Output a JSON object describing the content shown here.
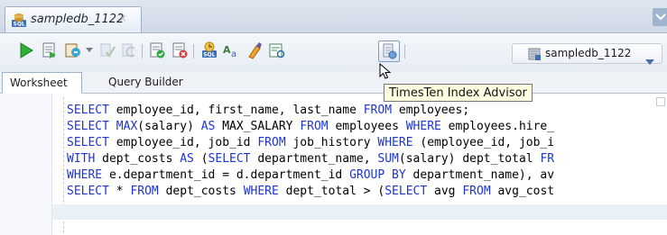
{
  "document_tab": {
    "label": "sampledb_1122",
    "close": "×"
  },
  "toolbar": {
    "buttons": [
      {
        "name": "run-statement-icon",
        "tooltip": ""
      },
      {
        "name": "run-script-icon"
      },
      {
        "name": "autotrace-icon"
      },
      {
        "name": "commit-icon"
      },
      {
        "name": "rollback-icon"
      },
      {
        "name": "explain-plan-icon"
      },
      {
        "name": "sql-tuning-icon"
      },
      {
        "name": "sql-history-icon"
      },
      {
        "name": "to-upper-icon"
      },
      {
        "name": "clear-icon"
      },
      {
        "name": "find-icon"
      },
      {
        "name": "timesten-index-advisor-icon"
      }
    ],
    "connection": "sampledb_1122"
  },
  "subtabs": {
    "worksheet": "Worksheet",
    "query_builder": "Query Builder"
  },
  "tooltip": "TimesTen Index Advisor",
  "editor": {
    "lines": [
      [
        {
          "t": "SELECT",
          "k": 1
        },
        {
          "t": " employee_id, first_name, last_name ",
          "k": 0
        },
        {
          "t": "FROM",
          "k": 1
        },
        {
          "t": " employees;",
          "k": 0
        }
      ],
      [
        {
          "t": "SELECT",
          "k": 1
        },
        {
          "t": " ",
          "k": 0
        },
        {
          "t": "MAX",
          "k": 1
        },
        {
          "t": "(salary) ",
          "k": 0
        },
        {
          "t": "AS",
          "k": 1
        },
        {
          "t": " MAX_SALARY ",
          "k": 0
        },
        {
          "t": "FROM",
          "k": 1
        },
        {
          "t": " employees ",
          "k": 0
        },
        {
          "t": "WHERE",
          "k": 1
        },
        {
          "t": " employees.hire_",
          "k": 0
        }
      ],
      [
        {
          "t": "SELECT",
          "k": 1
        },
        {
          "t": " employee_id, job_id ",
          "k": 0
        },
        {
          "t": "FROM",
          "k": 1
        },
        {
          "t": " job_history ",
          "k": 0
        },
        {
          "t": "WHERE",
          "k": 1
        },
        {
          "t": " (employee_id, job_i",
          "k": 0
        }
      ],
      [
        {
          "t": "WITH",
          "k": 1
        },
        {
          "t": " dept_costs ",
          "k": 0
        },
        {
          "t": "AS",
          "k": 1
        },
        {
          "t": " (",
          "k": 0
        },
        {
          "t": "SELECT",
          "k": 1
        },
        {
          "t": " department_name, ",
          "k": 0
        },
        {
          "t": "SUM",
          "k": 1
        },
        {
          "t": "(salary) dept_total ",
          "k": 0
        },
        {
          "t": "FR",
          "k": 1
        }
      ],
      [
        {
          "t": "WHERE",
          "k": 1
        },
        {
          "t": " e.department_id = d.department_id ",
          "k": 0
        },
        {
          "t": "GROUP BY",
          "k": 1
        },
        {
          "t": " department_name), av",
          "k": 0
        }
      ],
      [
        {
          "t": "SELECT",
          "k": 1
        },
        {
          "t": " * ",
          "k": 0
        },
        {
          "t": "FROM",
          "k": 1
        },
        {
          "t": " dept_costs ",
          "k": 0
        },
        {
          "t": "WHERE",
          "k": 1
        },
        {
          "t": " dept_total > (",
          "k": 0
        },
        {
          "t": "SELECT",
          "k": 1
        },
        {
          "t": " avg ",
          "k": 0
        },
        {
          "t": "FROM",
          "k": 1
        },
        {
          "t": " avg_cost",
          "k": 0
        }
      ]
    ]
  },
  "colors": {
    "keyword": "#1e35d6",
    "tooltip_bg": "#ffffe1"
  }
}
